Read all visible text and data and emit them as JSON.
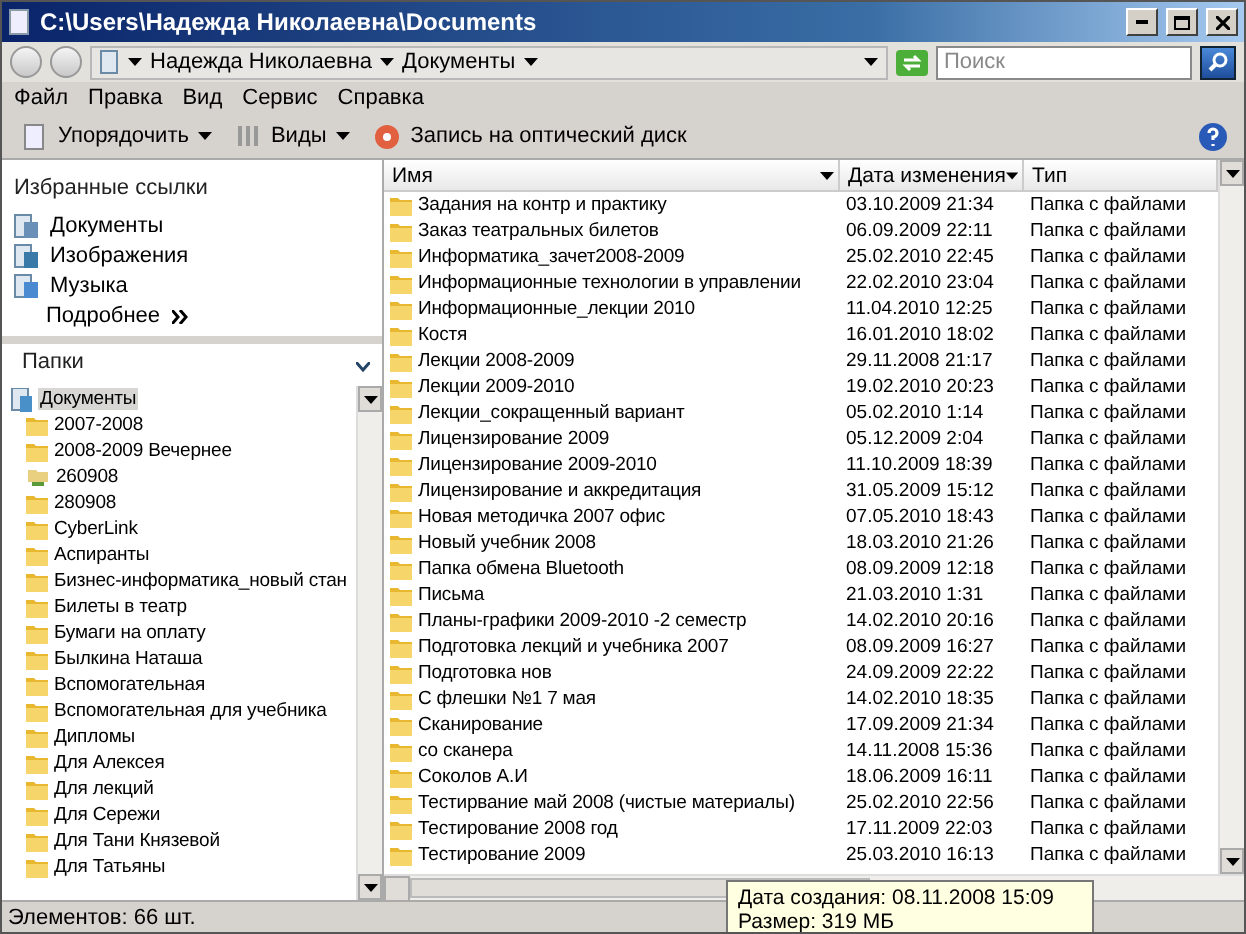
{
  "window": {
    "title": "C:\\Users\\Надежда Николаевна\\Documents"
  },
  "address": {
    "crumbs": [
      "Надежда Николаевна",
      "Документы"
    ],
    "search_placeholder": "Поиск"
  },
  "menu": [
    "Файл",
    "Правка",
    "Вид",
    "Сервис",
    "Справка"
  ],
  "toolbar": [
    "Упорядочить",
    "Виды",
    "Запись на оптический диск"
  ],
  "favorites": {
    "title": "Избранные ссылки",
    "items": [
      "Документы",
      "Изображения",
      "Музыка"
    ],
    "more": "Подробнее"
  },
  "folders": {
    "title": "Папки",
    "tree": [
      {
        "label": "Документы",
        "selected": true,
        "kind": "library",
        "children": [
          {
            "label": "2007-2008",
            "selected": false,
            "kind": "folder"
          },
          {
            "label": "2008-2009 Вечернее",
            "selected": false,
            "kind": "folder"
          },
          {
            "label": "260908",
            "selected": false,
            "kind": "shared"
          },
          {
            "label": "280908",
            "selected": false,
            "kind": "folder"
          },
          {
            "label": "CyberLink",
            "selected": false,
            "kind": "folder"
          },
          {
            "label": "Аспиранты",
            "selected": false,
            "kind": "folder"
          },
          {
            "label": "Бизнес-информатика_новый стан",
            "selected": false,
            "kind": "folder"
          },
          {
            "label": "Билеты в театр",
            "selected": false,
            "kind": "folder"
          },
          {
            "label": "Бумаги на оплату",
            "selected": false,
            "kind": "folder"
          },
          {
            "label": "Былкина Наташа",
            "selected": false,
            "kind": "folder"
          },
          {
            "label": "Вспомогательная",
            "selected": false,
            "kind": "folder"
          },
          {
            "label": "Вспомогательная для учебника",
            "selected": false,
            "kind": "folder"
          },
          {
            "label": "Дипломы",
            "selected": false,
            "kind": "folder"
          },
          {
            "label": "Для Алексея",
            "selected": false,
            "kind": "folder"
          },
          {
            "label": "Для лекций",
            "selected": false,
            "kind": "folder"
          },
          {
            "label": "Для Сережи",
            "selected": false,
            "kind": "folder"
          },
          {
            "label": "Для Тани Князевой",
            "selected": false,
            "kind": "folder"
          },
          {
            "label": "Для Татьяны",
            "selected": false,
            "kind": "folder"
          }
        ]
      }
    ]
  },
  "table": {
    "columns": [
      "Имя",
      "Дата изменения",
      "Тип"
    ],
    "rows": [
      [
        "Задания на контр и практику",
        "03.10.2009 21:34",
        "Папка с файлами"
      ],
      [
        "Заказ театральных билетов",
        "06.09.2009 22:11",
        "Папка с файлами"
      ],
      [
        "Информатика_зачет2008-2009",
        "25.02.2010 22:45",
        "Папка с файлами"
      ],
      [
        "Информационные технологии в управлении",
        "22.02.2010 23:04",
        "Папка с файлами"
      ],
      [
        "Информационные_лекции 2010",
        "11.04.2010 12:25",
        "Папка с файлами"
      ],
      [
        "Костя",
        "16.01.2010 18:02",
        "Папка с файлами"
      ],
      [
        "Лекции 2008-2009",
        "29.11.2008 21:17",
        "Папка с файлами"
      ],
      [
        "Лекции 2009-2010",
        "19.02.2010 20:23",
        "Папка с файлами"
      ],
      [
        "Лекции_сокращенный вариант",
        "05.02.2010 1:14",
        "Папка с файлами"
      ],
      [
        "Лицензирование 2009",
        "05.12.2009 2:04",
        "Папка с файлами"
      ],
      [
        "Лицензирование 2009-2010",
        "11.10.2009 18:39",
        "Папка с файлами"
      ],
      [
        "Лицензирование и аккредитация",
        "31.05.2009 15:12",
        "Папка с файлами"
      ],
      [
        "Новая методичка 2007 офис",
        "07.05.2010 18:43",
        "Папка с файлами"
      ],
      [
        "Новый учебник 2008",
        "18.03.2010 21:26",
        "Папка с файлами"
      ],
      [
        "Папка обмена Bluetooth",
        "08.09.2009 12:18",
        "Папка с файлами"
      ],
      [
        "Письма",
        "21.03.2010 1:31",
        "Папка с файлами"
      ],
      [
        "Планы-графики 2009-2010 -2 семестр",
        "14.02.2010 20:16",
        "Папка с файлами"
      ],
      [
        "Подготовка лекций и учебника 2007",
        "08.09.2009 16:27",
        "Папка с файлами"
      ],
      [
        "Подготовка нов",
        "24.09.2009 22:22",
        "Папка с файлами"
      ],
      [
        "С флешки №1 7 мая",
        "14.02.2010 18:35",
        "Папка с файлами"
      ],
      [
        "Сканирование",
        "17.09.2009 21:34",
        "Папка с файлами"
      ],
      [
        "со сканера",
        "14.11.2008 15:36",
        "Папка с файлами"
      ],
      [
        "Соколов А.И",
        "18.06.2009 16:11",
        "Папка с файлами"
      ],
      [
        "Тестирвание май 2008 (чистые материалы)",
        "25.02.2010 22:56",
        "Папка с файлами"
      ],
      [
        "Тестирование 2008 год",
        "17.11.2009 22:03",
        "Папка с файлами"
      ],
      [
        "Тестирование 2009",
        "25.03.2010 16:13",
        "Папка с файлами"
      ]
    ]
  },
  "tooltip": [
    "Дата создания: 08.11.2008 15:09",
    "Размер: 319 МБ"
  ],
  "status_bar": "Элементов: 66 шт."
}
